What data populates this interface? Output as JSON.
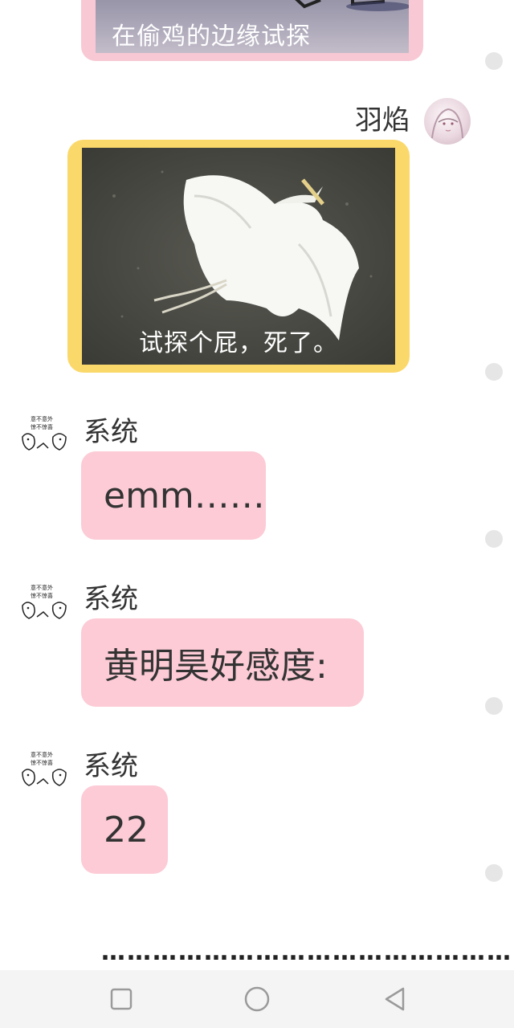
{
  "messages": {
    "top_image_caption": "在偷鸡的边缘试探",
    "me": {
      "name": "羽焰",
      "image_caption": "试探个屁，死了。"
    },
    "system": [
      {
        "name": "系统",
        "text": "emm……"
      },
      {
        "name": "系统",
        "text": "黄明昊好感度:"
      },
      {
        "name": "系统",
        "text": "22"
      }
    ],
    "ellipsis": "…………………………………………"
  },
  "colors": {
    "accent_pink": "#fccbd6",
    "accent_yellow": "#fbd86a",
    "nav_bg": "#f4f4f4"
  },
  "nav": {
    "icons": [
      "square-icon",
      "circle-icon",
      "back-triangle-icon"
    ]
  }
}
